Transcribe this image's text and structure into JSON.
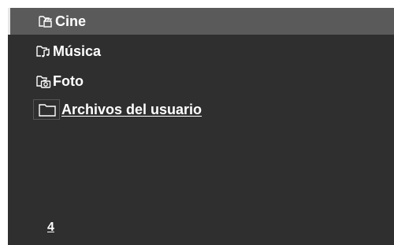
{
  "menu": {
    "items": [
      {
        "label": "Cine",
        "icon": "movie-folder-icon",
        "selected": true
      },
      {
        "label": "Música",
        "icon": "music-folder-icon",
        "selected": false
      },
      {
        "label": "Foto",
        "icon": "photo-folder-icon",
        "selected": false
      },
      {
        "label": "Archivos del usuario",
        "icon": "folder-icon",
        "selected": false
      }
    ]
  },
  "footer": {
    "page_number": "4"
  },
  "colors": {
    "background": "#2f2f2f",
    "selected_row": "#5a5a5a",
    "text": "#ffffff"
  }
}
